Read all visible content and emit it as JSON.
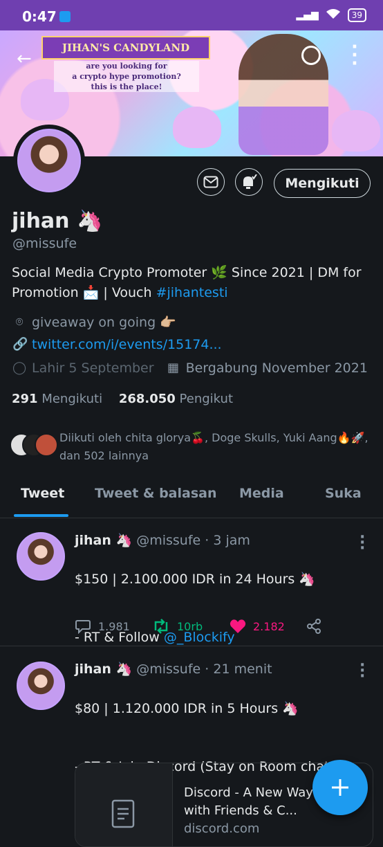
{
  "status_bar": {
    "time": "0:47",
    "battery": "39"
  },
  "banner": {
    "title": "JIHAN'S CANDYLAND",
    "subtitle_lines": [
      "are you looking for",
      "a crypto hype promotion?",
      "this is the place!"
    ]
  },
  "profile": {
    "follow_button": "Mengikuti",
    "display_name": "jihan 🦄",
    "handle": "@missufe",
    "bio_text": "Social Media Crypto Promoter 🌿 Since 2021 | DM for Promotion 📩 | Vouch ",
    "bio_hashtag": "#jihantesti",
    "location": "giveaway on going 👉🏼",
    "website": "twitter.com/i/events/15174...",
    "birthday": "Lahir 5 September",
    "joined": "Bergabung November 2021",
    "following_count": "291",
    "following_label": "Mengikuti",
    "followers_count": "268.050",
    "followers_label": "Pengikut",
    "followed_by": "Diikuti oleh chita glorya🍒, Doge Skulls, Yuki Aang🔥🚀, dan 502 lainnya"
  },
  "tabs": [
    {
      "label": "Tweet",
      "active": true
    },
    {
      "label": "Tweet & balasan",
      "active": false
    },
    {
      "label": "Media",
      "active": false
    },
    {
      "label": "Suka",
      "active": false
    }
  ],
  "tweets": [
    {
      "name": "jihan 🦄",
      "handle": "@missufe",
      "time": "· 3 jam",
      "line1": "$150 | 2.100.000 IDR in 24 Hours 🦄",
      "line2_prefix": "- RT & Follow ",
      "line2_mention": "@_Blockify",
      "replies": "1.981",
      "retweets": "10rb",
      "likes": "2.182"
    },
    {
      "name": "jihan 🦄",
      "handle": "@missufe",
      "time": "· 21 menit",
      "line1": "$80 | 1.120.000 IDR in 5 Hours 🦄",
      "line2": "- RT & Join Discord (Stay on Room chat + Post Proof)",
      "card_title": "Discord - A New Way to Chat with Friends & C...",
      "card_domain": "discord.com"
    }
  ],
  "colors": {
    "accent": "#1d9bf0",
    "retweet": "#00ba7c",
    "like": "#f91880",
    "background": "#15181c",
    "status_bar": "#6f3fb0"
  }
}
